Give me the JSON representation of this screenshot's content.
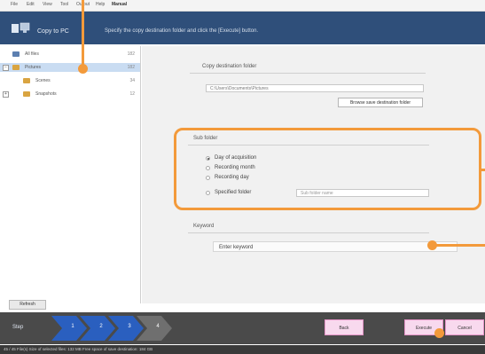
{
  "menu": [
    "File",
    "Edit",
    "View",
    "Tool",
    "Output",
    "Help",
    "Manual"
  ],
  "header": {
    "title": "Copy to PC",
    "instruction": "Specify the copy destination folder and click the [Execute] button."
  },
  "tree": {
    "items": [
      {
        "label": "All files",
        "count": "182"
      },
      {
        "label": "Pictures",
        "count": "182"
      },
      {
        "label": "Scenes",
        "count": "34"
      },
      {
        "label": "Snapshots",
        "count": "12"
      }
    ],
    "refresh_label": "Refresh"
  },
  "copy_destination": {
    "label": "Copy destination folder",
    "path": "C:\\Users\\Documents\\Pictures",
    "browse_label": "Browse save destination folder"
  },
  "sub_folder": {
    "label": "Sub folder",
    "options": [
      {
        "label": "Day of acquisition",
        "selected": true
      },
      {
        "label": "Recording month",
        "selected": false
      },
      {
        "label": "Recording day",
        "selected": false
      },
      {
        "label": "Specified folder",
        "selected": false
      }
    ],
    "name_placeholder": "Sub folder name"
  },
  "keyword": {
    "label": "Keyword",
    "placeholder": "Enter keyword"
  },
  "steps": {
    "label": "Step",
    "numbers": [
      "1",
      "2",
      "3",
      "4"
    ]
  },
  "buttons": {
    "back": "Back",
    "execute": "Execute",
    "cancel": "Cancel"
  },
  "status": "45 / 45 File(s)   Size of selected files: 132 MB   Free space of save destination: 184 GB",
  "colors": {
    "header_bg": "#2f4f7a",
    "callout": "#f39a3b",
    "step_arrow": "#2a5fbf",
    "button_pink": "#f8d9ee"
  }
}
